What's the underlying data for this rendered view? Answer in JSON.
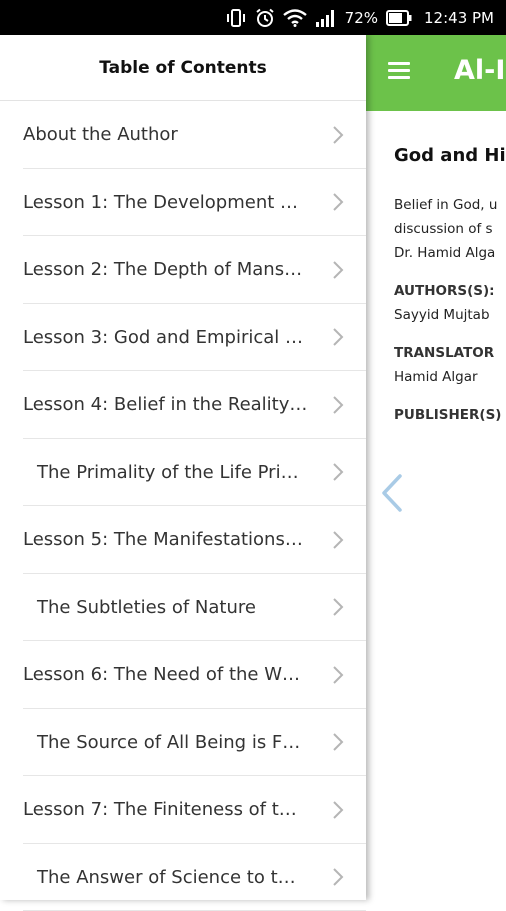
{
  "status_bar": {
    "battery_percent": "72%",
    "time": "12:43 PM",
    "icons": [
      "vibrate-icon",
      "alarm-icon",
      "wifi-icon",
      "signal-icon",
      "battery-icon"
    ]
  },
  "app": {
    "title": "Al-Is",
    "accent_color": "#6cc24a",
    "book": {
      "title": "God and Hi",
      "description_lines": [
        "Belief in God, u",
        "discussion of s",
        "Dr. Hamid Alga"
      ],
      "authors_label": "AUTHORS(S):",
      "authors_value": "Sayyid Mujtab",
      "translators_label": "TRANSLATOR",
      "translators_value": "Hamid Algar",
      "publishers_label": "PUBLISHER(S)"
    }
  },
  "drawer": {
    "title": "Table of Contents",
    "items": [
      {
        "label": "About the Author",
        "sub": false
      },
      {
        "label": "Lesson 1: The Development of…",
        "sub": false
      },
      {
        "label": "Lesson 2: The Depth of Mans…",
        "sub": false
      },
      {
        "label": "Lesson 3: God and Empirical …",
        "sub": false
      },
      {
        "label": "Lesson 4: Belief in the Reality…",
        "sub": false
      },
      {
        "label": "The Primality of the Life Pri…",
        "sub": true
      },
      {
        "label": "Lesson 5: The Manifestations…",
        "sub": false
      },
      {
        "label": "The Subtleties of Nature",
        "sub": true
      },
      {
        "label": "Lesson 6: The Need of the W…",
        "sub": false
      },
      {
        "label": "The Source of All Being is F…",
        "sub": true
      },
      {
        "label": "Lesson 7: The Finiteness of t…",
        "sub": false
      },
      {
        "label": "The Answer of Science to t…",
        "sub": true
      }
    ]
  }
}
